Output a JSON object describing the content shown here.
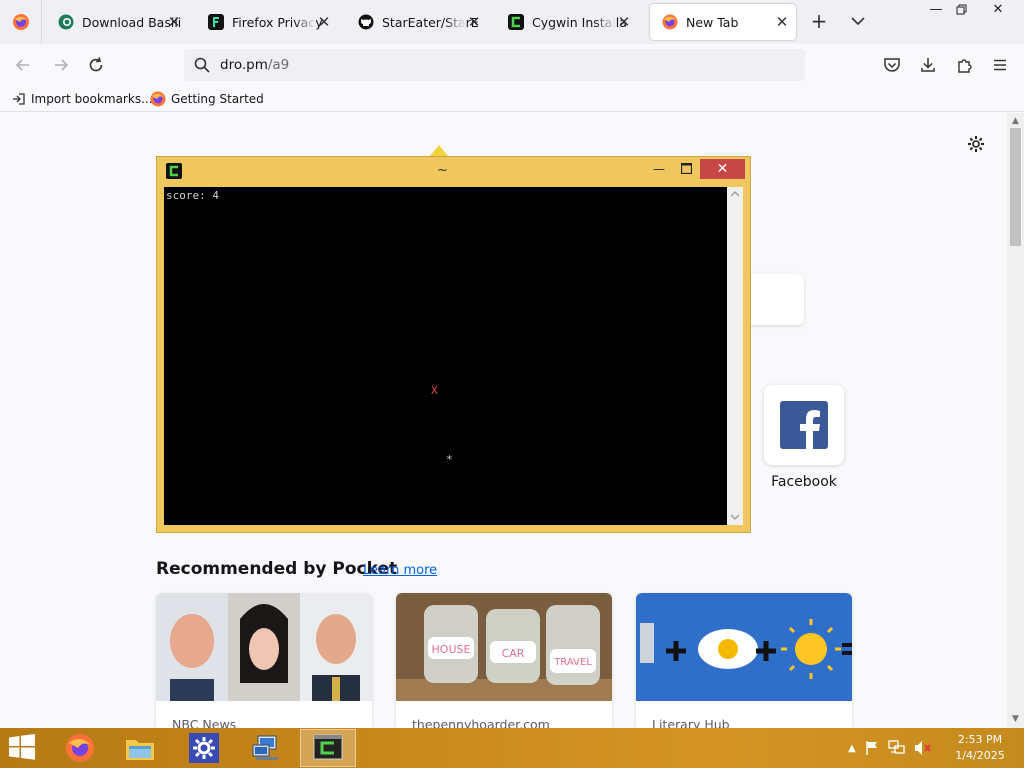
{
  "browser": {
    "tabs": [
      {
        "label": "Download Basilisk",
        "icon": "basilisk-icon"
      },
      {
        "label": "Firefox Privacy Notice",
        "icon": "mozilla-icon"
      },
      {
        "label": "StarEater/StarEater",
        "icon": "github-icon"
      },
      {
        "label": "Cygwin Installation",
        "icon": "cygwin-icon"
      },
      {
        "label": "New Tab",
        "icon": "firefox-icon",
        "active": true
      }
    ],
    "url": {
      "host": "dro.pm",
      "path": "/a9"
    },
    "bookmarks": [
      {
        "label": "Import bookmarks...",
        "icon": "import-icon"
      },
      {
        "label": "Getting Started",
        "icon": "firefox-icon"
      }
    ]
  },
  "new_tab": {
    "shortcut": {
      "label": "Facebook",
      "icon": "facebook-icon"
    },
    "pocket": {
      "title": "Recommended by Pocket",
      "learn_more": "Learn more",
      "cards": [
        {
          "source": "NBC News"
        },
        {
          "source": "thepennyhoarder.com",
          "jar_labels": [
            "HOUSE",
            "CAR",
            "TRAVEL"
          ]
        },
        {
          "source": "Literary Hub"
        }
      ]
    }
  },
  "terminal": {
    "title": "~",
    "score_text": "score: 4",
    "target_char": "X",
    "player_char": "*"
  },
  "taskbar": {
    "apps": [
      "firefox-icon",
      "file-explorer-icon",
      "settings-icon",
      "network-computer-icon",
      "cygwin-terminal-icon"
    ],
    "active_app": "cygwin-terminal-icon",
    "time": "2:53 PM",
    "date": "1/4/2025"
  },
  "colors": {
    "accent": "#0061e0",
    "terminal_frame": "#f0c75e",
    "taskbar": "#c98a1c",
    "close_red": "#c74747"
  }
}
